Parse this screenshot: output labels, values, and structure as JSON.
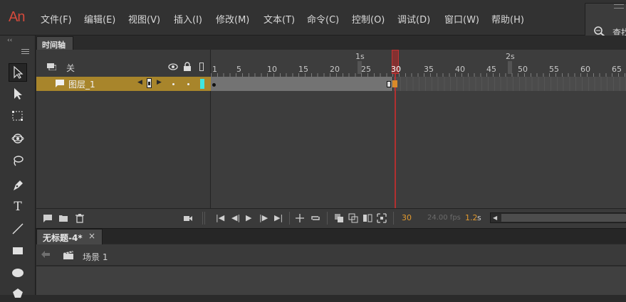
{
  "app": {
    "logo": "An"
  },
  "menu": [
    "文件(F)",
    "编辑(E)",
    "视图(V)",
    "插入(I)",
    "修改(M)",
    "文本(T)",
    "命令(C)",
    "控制(O)",
    "调试(D)",
    "窗口(W)",
    "帮助(H)"
  ],
  "search": {
    "label": "查找"
  },
  "toolbar": {
    "collapse": "‹‹",
    "text_tool": "T"
  },
  "timeline": {
    "tab_label": "时间轴",
    "header_label": "关",
    "layer_name": "图层_1",
    "layer_color": "#3fe6e0",
    "second_labels": [
      "1s",
      "2s"
    ],
    "frame_labels": [
      "1",
      "5",
      "10",
      "15",
      "20",
      "25",
      "30",
      "35",
      "40",
      "45",
      "50",
      "55",
      "60",
      "65"
    ],
    "playhead_frame": "30",
    "footer": {
      "current_frame": "30",
      "fps": "24.00 fps",
      "time_value": "1.2",
      "time_unit": "s"
    }
  },
  "document": {
    "tab_label": "无标题-4*",
    "close": "×",
    "scene_label": "场景 1"
  }
}
